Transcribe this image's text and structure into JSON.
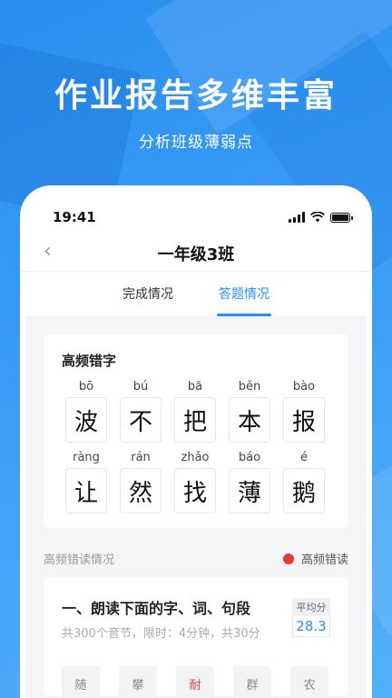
{
  "hero": {
    "title": "作业报告多维丰富",
    "subtitle": "分析班级薄弱点"
  },
  "status_bar": {
    "time": "19:41"
  },
  "nav": {
    "title": "一年级3班"
  },
  "tabs": [
    {
      "label": "完成情况",
      "active": false
    },
    {
      "label": "答题情况",
      "active": true
    }
  ],
  "frequent_errors": {
    "title": "高频错字",
    "chars": [
      {
        "pinyin": "bō",
        "char": "波"
      },
      {
        "pinyin": "bú",
        "char": "不"
      },
      {
        "pinyin": "bă",
        "char": "把"
      },
      {
        "pinyin": "běn",
        "char": "本"
      },
      {
        "pinyin": "bào",
        "char": "报"
      },
      {
        "pinyin": "ràng",
        "char": "让"
      },
      {
        "pinyin": "rán",
        "char": "然"
      },
      {
        "pinyin": "zhǎo",
        "char": "找"
      },
      {
        "pinyin": "báo",
        "char": "薄"
      },
      {
        "pinyin": "é",
        "char": "鹅"
      }
    ]
  },
  "reading_section": {
    "title": "高频错读情况",
    "legend_label": "高频错读",
    "legend_color": "#e53935"
  },
  "exercise": {
    "title": "一、朗读下面的字、词、句段",
    "meta": "共300个音节，限时：4分钟，共30分",
    "avg_label": "平均分",
    "avg_value": "28.3",
    "bottom_chars": [
      {
        "char": "随",
        "wrong": false
      },
      {
        "char": "攀",
        "wrong": false
      },
      {
        "char": "耐",
        "wrong": true
      },
      {
        "char": "群",
        "wrong": false
      },
      {
        "char": "农",
        "wrong": false
      }
    ]
  },
  "colors": {
    "accent": "#2a8ff0",
    "error": "#e53935"
  }
}
